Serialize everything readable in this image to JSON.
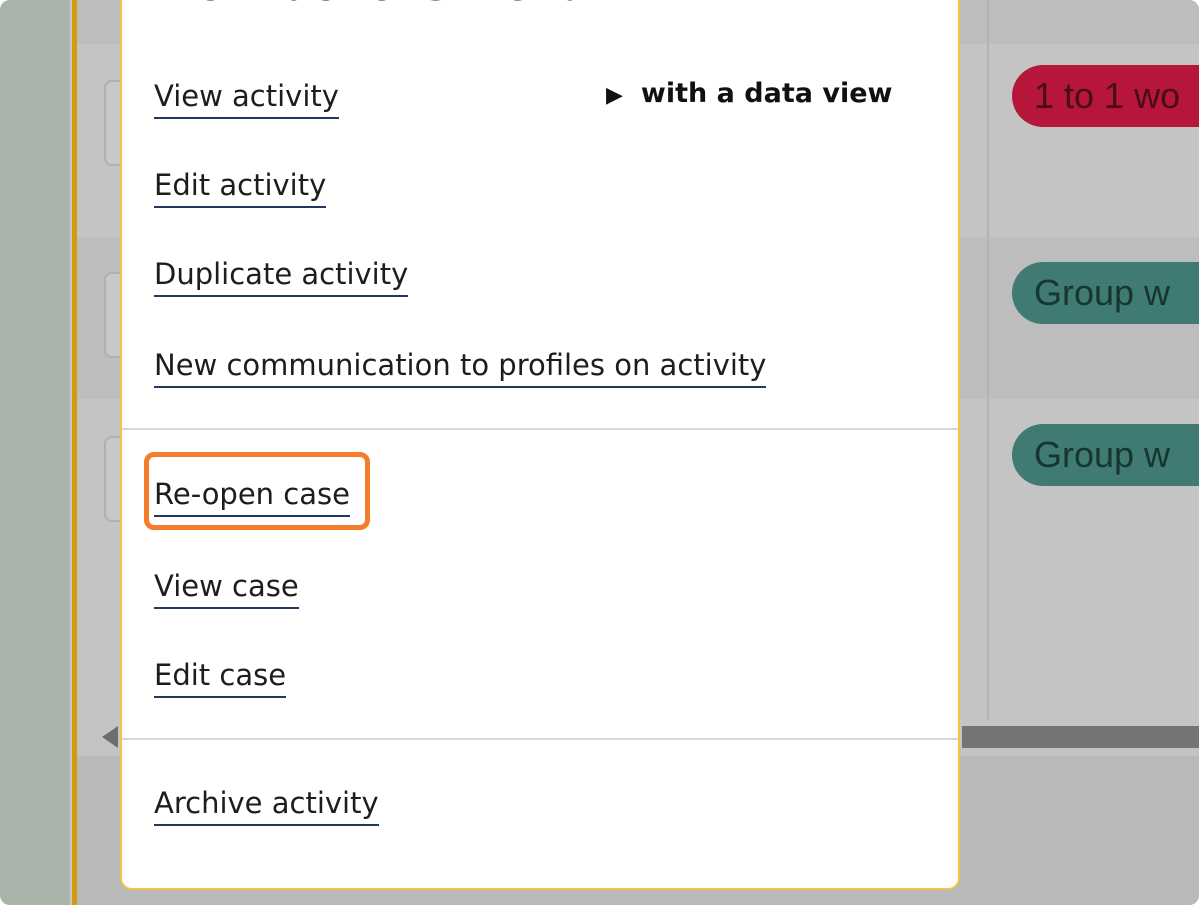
{
  "menu": {
    "title": "Work actions menu",
    "submenu_hint": "with a data view",
    "items_group1": [
      {
        "label": "View activity"
      },
      {
        "label": "Edit activity"
      },
      {
        "label": "Duplicate activity"
      },
      {
        "label": "New communication to profiles on activity"
      }
    ],
    "items_group2": [
      {
        "label": "Re-open case"
      },
      {
        "label": "View case"
      },
      {
        "label": "Edit case"
      }
    ],
    "items_group3": [
      {
        "label": "Archive activity"
      }
    ]
  },
  "background": {
    "pills": [
      {
        "label": "1 to 1 wo",
        "color": "#b5163a"
      },
      {
        "label": "Group w",
        "color": "#3f7a73"
      },
      {
        "label": "Group w",
        "color": "#3f7a73"
      }
    ]
  },
  "colors": {
    "highlight": "#f57c2a",
    "menu_border": "#f3c544",
    "link_underline": "#1f3a5c"
  },
  "icons": {
    "submenu": "play-arrow-icon",
    "scroll_left": "scroll-left-arrow-icon"
  }
}
